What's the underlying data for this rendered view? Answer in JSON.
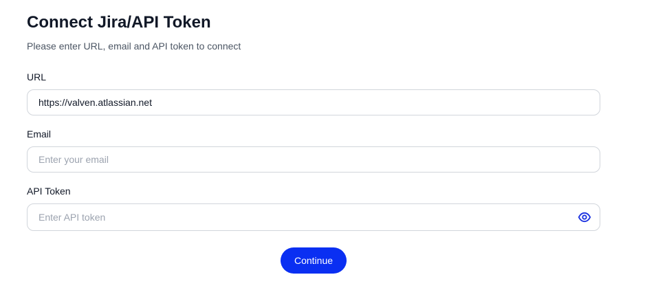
{
  "header": {
    "title": "Connect Jira/API Token",
    "subtitle": "Please enter URL, email and API token to connect"
  },
  "form": {
    "url": {
      "label": "URL",
      "value": "https://valven.atlassian.net",
      "placeholder": ""
    },
    "email": {
      "label": "Email",
      "value": "",
      "placeholder": "Enter your email"
    },
    "token": {
      "label": "API Token",
      "value": "",
      "placeholder": "Enter API token",
      "toggle_icon": "eye-icon"
    }
  },
  "actions": {
    "continue_label": "Continue"
  },
  "colors": {
    "accent": "#0a2ff2",
    "border": "#d1d5db",
    "placeholder": "#9ca3af"
  }
}
